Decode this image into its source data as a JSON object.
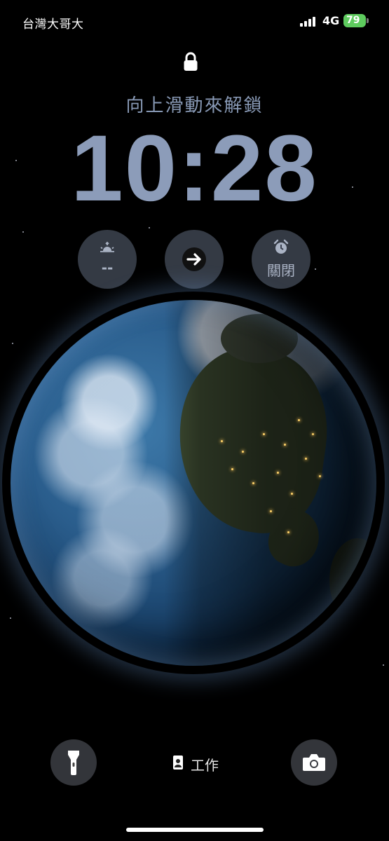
{
  "status_bar": {
    "carrier": "台灣大哥大",
    "network": "4G",
    "battery": "79"
  },
  "lock_screen": {
    "unlock_hint": "向上滑動來解鎖",
    "time": "10:28",
    "widgets": [
      {
        "icon": "sunrise-icon",
        "label": "--"
      },
      {
        "icon": "arrow-right-icon",
        "label": ""
      },
      {
        "icon": "alarm-clock-icon",
        "label": "關閉"
      }
    ],
    "focus": {
      "label": "工作"
    }
  },
  "wallpaper": "earth",
  "colors": {
    "accent": "#8c9cb9",
    "battery": "#5ecb5e"
  }
}
